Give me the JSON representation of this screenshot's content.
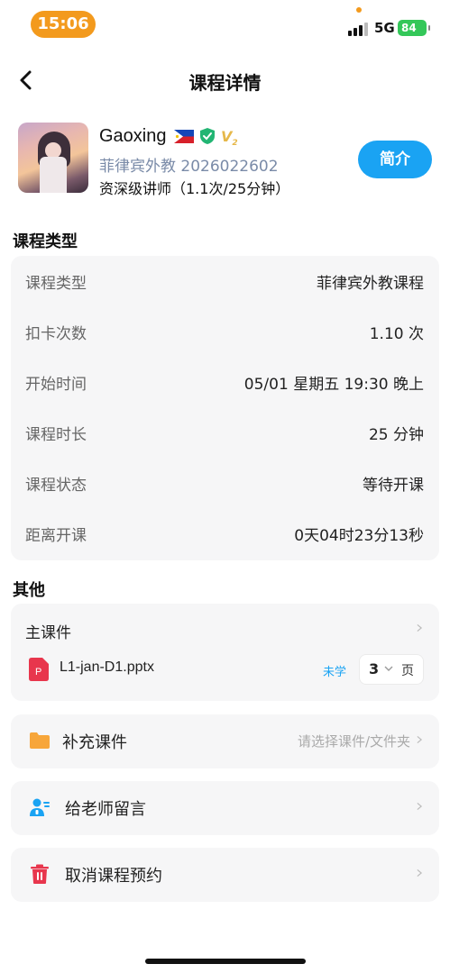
{
  "status_bar": {
    "time": "15:06",
    "network": "5G",
    "battery": "84"
  },
  "nav": {
    "title": "课程详情"
  },
  "teacher": {
    "name": "Gaoxing",
    "id_line": "菲律宾外教 2026022602",
    "level_line": "资深级讲师（1.1次/25分钟）",
    "vip_badge": "V",
    "intro_button": "简介",
    "flag_icon": "philippines-flag-icon",
    "verified_icon": "verified-shield-icon",
    "vip_icon": "vip-level-icon"
  },
  "course_section": {
    "title": "课程类型",
    "rows": [
      {
        "label": "课程类型",
        "value": "菲律宾外教课程"
      },
      {
        "label": "扣卡次数",
        "value": "1.10 次"
      },
      {
        "label": "开始时间",
        "value": "05/01 星期五 19:30 晚上"
      },
      {
        "label": "课程时长",
        "value": "25 分钟"
      },
      {
        "label": "课程状态",
        "value": "等待开课"
      },
      {
        "label": "距离开课",
        "value": "0天04时23分13秒"
      }
    ]
  },
  "other_section": {
    "title": "其他",
    "main_courseware": {
      "title": "主课件",
      "file_name": "L1-jan-D1.pptx",
      "status": "未学",
      "page_count": "3",
      "page_unit": "页"
    },
    "supplement": {
      "label": "补充课件",
      "hint": "请选择课件/文件夹"
    },
    "message": {
      "label": "给老师留言"
    },
    "cancel": {
      "label": "取消课程预约"
    }
  },
  "colors": {
    "accent_blue": "#1aa3f3",
    "time_pill": "#f39a1d",
    "battery_green": "#34c759",
    "folder_orange": "#f7a63a",
    "danger_red": "#e8364d",
    "card_bg": "#f6f6f7"
  }
}
